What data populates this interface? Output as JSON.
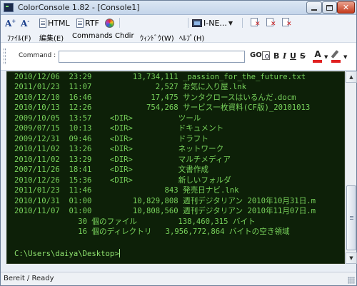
{
  "window": {
    "title": "ColorConsole 1.82  - [Console1]",
    "minimize_icon": "minimize-icon",
    "maximize_icon": "maximize-icon",
    "close_glyph": "✕"
  },
  "toolbar": {
    "font_larger": "A",
    "font_smaller": "A",
    "font_larger_sup": "+",
    "font_smaller_sup": "-",
    "html_label": "HTML",
    "rtf_label": "RTF",
    "console_select": "I-NE...",
    "dropdown_glyph": "▼"
  },
  "menu": {
    "items": [
      "ﾌｧｲﾙ(F)",
      "編集(E)",
      "Commands",
      "Chdir",
      "ｳｨﾝﾄﾞｳ(W)",
      "ﾍﾙﾌﾟ(H)"
    ]
  },
  "command_bar": {
    "label": "Command :",
    "input_value": "",
    "go_label": "GO",
    "bold_label": "B",
    "italic_label": "I",
    "underline_label": "U",
    "strike_label": "S",
    "font_color_label": "A",
    "arrow_glyph": "▼",
    "font_color": "#e02020",
    "background_color": "#e02020"
  },
  "console": {
    "background": "#0d2008",
    "text_color": "#78d25b",
    "lines": [
      "2010/12/06  23:29         13,734,111 _passion_for_the_future.txt",
      "2011/01/23  11:07              2,527 お気に入り屋.lnk",
      "2010/12/10  16:46             17,475 サンタクロースはいるんだ.docm",
      "2010/10/13  12:26            754,268 サービス一枚資料(CF版)_20101013",
      "2009/10/05  13:57    <DIR>          ツール",
      "2009/07/15  10:13    <DIR>          ドキュメント",
      "2009/12/31  09:46    <DIR>          ドラフト",
      "2010/11/02  13:26    <DIR>          ネットワーク",
      "2010/11/02  13:29    <DIR>          マルチメディア",
      "2007/11/26  18:41    <DIR>          文書作成",
      "2010/12/26  15:36    <DIR>          新しいフォルダ",
      "2011/01/23  11:46                843 発売日ナビ.lnk",
      "2010/10/31  01:00         10,829,808 週刊デジタリアン 2010年10月31日.m",
      "2010/11/07  01:00         10,808,560 週刊デジタリアン 2010年11月07日.m",
      "              30 個のファイル         138,460,315 バイト",
      "              16 個のディレクトリ   3,956,772,864 バイトの空き領域",
      "",
      "C:\\Users\\daiya\\Desktop>"
    ]
  },
  "status_bar": {
    "text": "Bereit / Ready"
  }
}
